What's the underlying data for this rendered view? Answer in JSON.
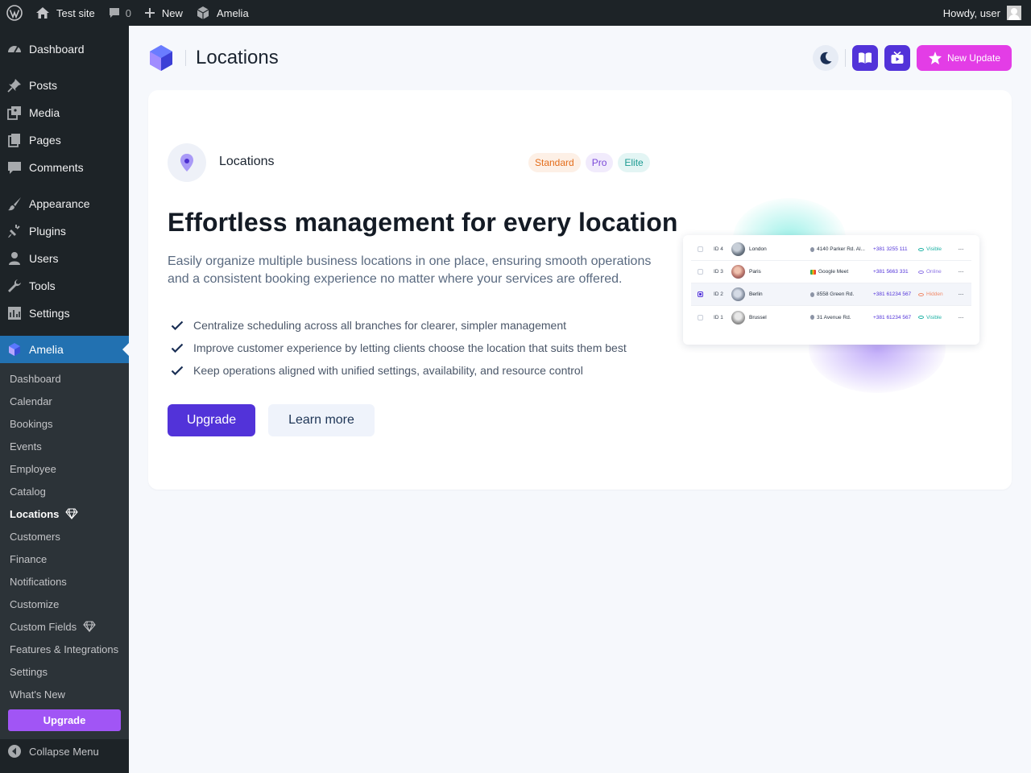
{
  "admin_bar": {
    "site_name": "Test site",
    "comments_count": "0",
    "new_label": "New",
    "plugin_label": "Amelia",
    "greeting": "Howdy, user"
  },
  "sidebar": {
    "menu": [
      {
        "label": "Dashboard",
        "icon": "dashboard-icon"
      },
      {
        "label": "Posts",
        "icon": "pin-icon"
      },
      {
        "label": "Media",
        "icon": "media-icon"
      },
      {
        "label": "Pages",
        "icon": "pages-icon"
      },
      {
        "label": "Comments",
        "icon": "comment-icon"
      },
      {
        "label": "Appearance",
        "icon": "brush-icon"
      },
      {
        "label": "Plugins",
        "icon": "plug-icon"
      },
      {
        "label": "Users",
        "icon": "user-icon"
      },
      {
        "label": "Tools",
        "icon": "wrench-icon"
      },
      {
        "label": "Settings",
        "icon": "settings-icon"
      },
      {
        "label": "Amelia",
        "icon": "amelia-logo-icon"
      }
    ],
    "submenu": [
      {
        "label": "Dashboard"
      },
      {
        "label": "Calendar"
      },
      {
        "label": "Bookings"
      },
      {
        "label": "Events"
      },
      {
        "label": "Employee"
      },
      {
        "label": "Catalog"
      },
      {
        "label": "Locations"
      },
      {
        "label": "Customers"
      },
      {
        "label": "Finance"
      },
      {
        "label": "Notifications"
      },
      {
        "label": "Customize"
      },
      {
        "label": "Custom Fields"
      },
      {
        "label": "Features & Integrations"
      },
      {
        "label": "Settings"
      },
      {
        "label": "What's New"
      }
    ],
    "upgrade_label": "Upgrade",
    "collapse_label": "Collapse Menu"
  },
  "header": {
    "title": "Locations",
    "new_update_label": "New Update"
  },
  "feature": {
    "name": "Locations",
    "badges": [
      "Standard",
      "Pro",
      "Elite"
    ],
    "headline": "Effortless management for every location",
    "description": "Easily organize multiple business locations in one place, ensuring smooth operations and a consistent booking experience no matter where your services are offered.",
    "benefits": [
      "Centralize scheduling across all branches for clearer, simpler management",
      "Improve customer experience by letting clients choose the location that suits them best",
      "Keep operations aligned with unified settings, availability, and resource control"
    ],
    "upgrade_label": "Upgrade",
    "learn_more_label": "Learn more"
  },
  "preview_table": {
    "rows": [
      {
        "id": "ID 4",
        "name": "London",
        "address": "4140 Parker Rd. Al...",
        "phone": "+381 3255 111",
        "status": "Visible"
      },
      {
        "id": "ID 3",
        "name": "Paris",
        "address": "Google Meet",
        "phone": "+381 5663 331",
        "status": "Online"
      },
      {
        "id": "ID 2",
        "name": "Berlin",
        "address": "8558 Green Rd.",
        "phone": "+381 61234 567",
        "status": "Hidden"
      },
      {
        "id": "ID 1",
        "name": "Brussel",
        "address": "31 Avenue Rd.",
        "phone": "+381 61234 567",
        "status": "Visible"
      }
    ]
  },
  "colors": {
    "primary": "#5233d9",
    "accent_pink": "#e33de6",
    "wp_blue": "#2271b1",
    "wp_dark": "#1d2327"
  }
}
